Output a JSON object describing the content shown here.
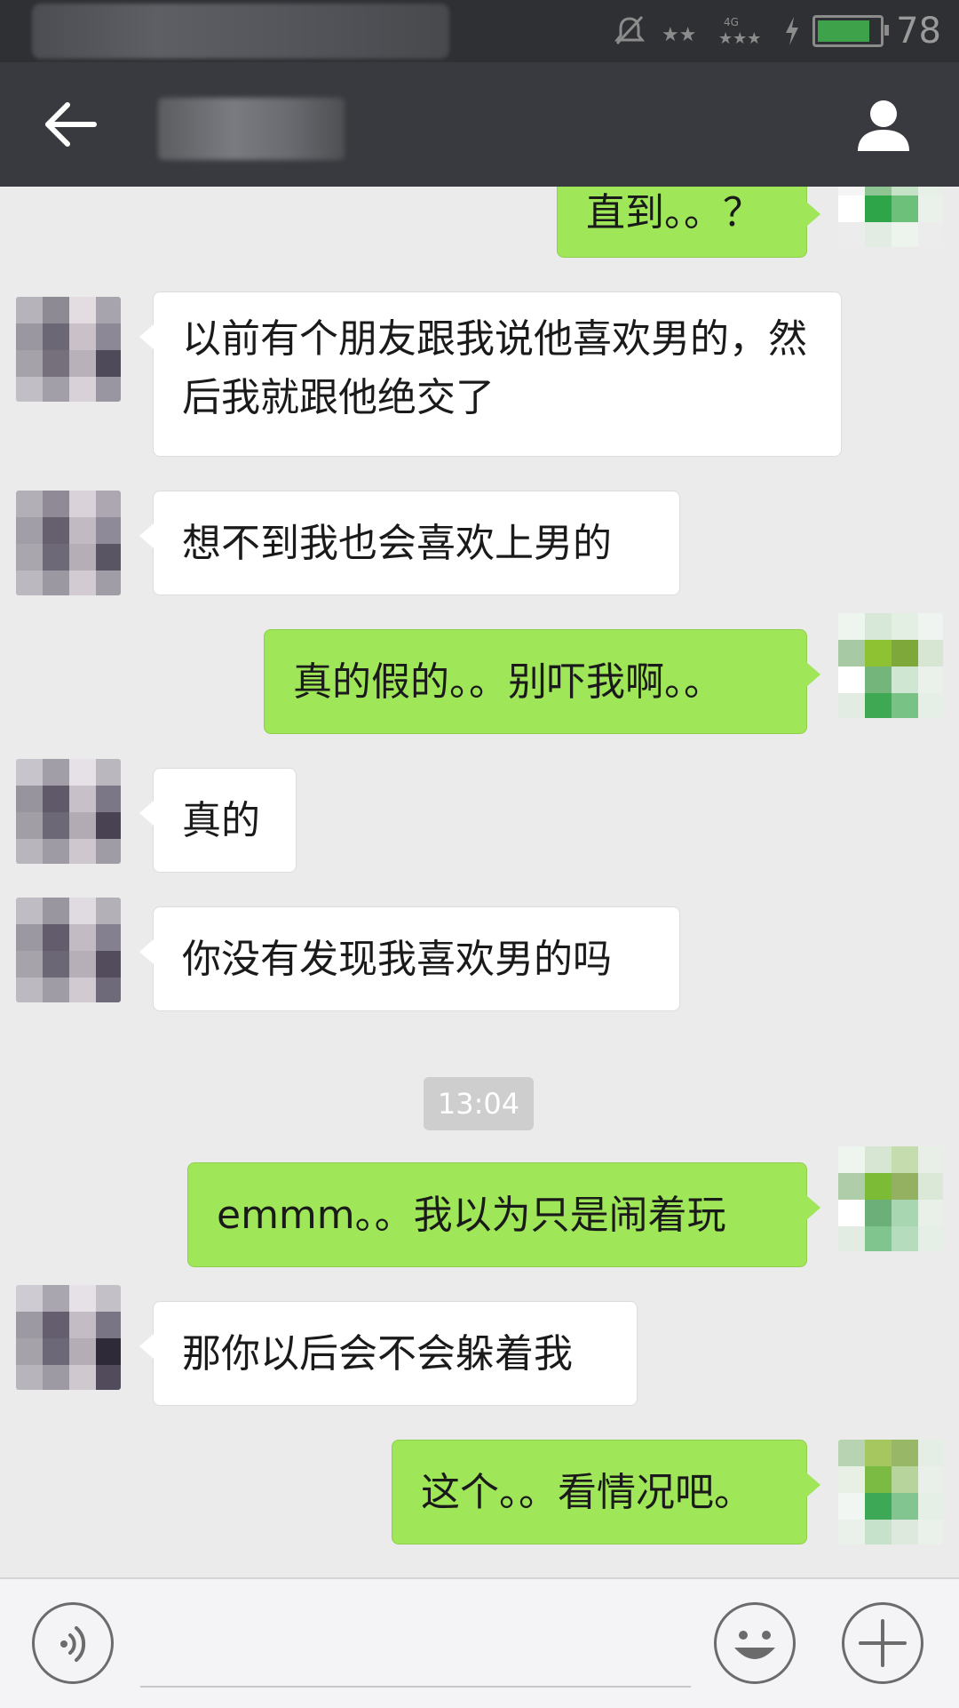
{
  "status_bar": {
    "battery_level": "78",
    "network": "4G",
    "icons": [
      "mute-bell-icon",
      "signal-icon",
      "signal-4g-icon",
      "charging-icon",
      "battery-icon"
    ],
    "battery_color": "#3ea24a"
  },
  "header": {
    "back_icon": "back-arrow-icon",
    "contact_icon": "contact-profile-icon",
    "background": "#393a3f"
  },
  "messages": [
    {
      "side": "out",
      "text": "直到。。？"
    },
    {
      "side": "in",
      "text": "以前有个朋友跟我说他喜欢男的，然后我就跟他绝交了"
    },
    {
      "side": "in",
      "text": "想不到我也会喜欢上男的"
    },
    {
      "side": "out",
      "text": "真的假的。。别吓我啊。。"
    },
    {
      "side": "in",
      "text": "真的"
    },
    {
      "side": "in",
      "text": "你没有发现我喜欢男的吗"
    },
    {
      "side": "out",
      "text": "emmm。。我以为只是闹着玩"
    },
    {
      "side": "in",
      "text": "那你以后会不会躲着我"
    },
    {
      "side": "out",
      "text": "这个。。看情况吧。"
    }
  ],
  "timestamp": "13:04",
  "bottom_bar": {
    "voice_icon": "voice-input-icon",
    "emoji_icon": "emoji-icon",
    "more_icon": "plus-icon"
  },
  "colors": {
    "outgoing_bubble": "#9fe658",
    "incoming_bubble": "#ffffff",
    "chat_background": "#ebebeb"
  }
}
